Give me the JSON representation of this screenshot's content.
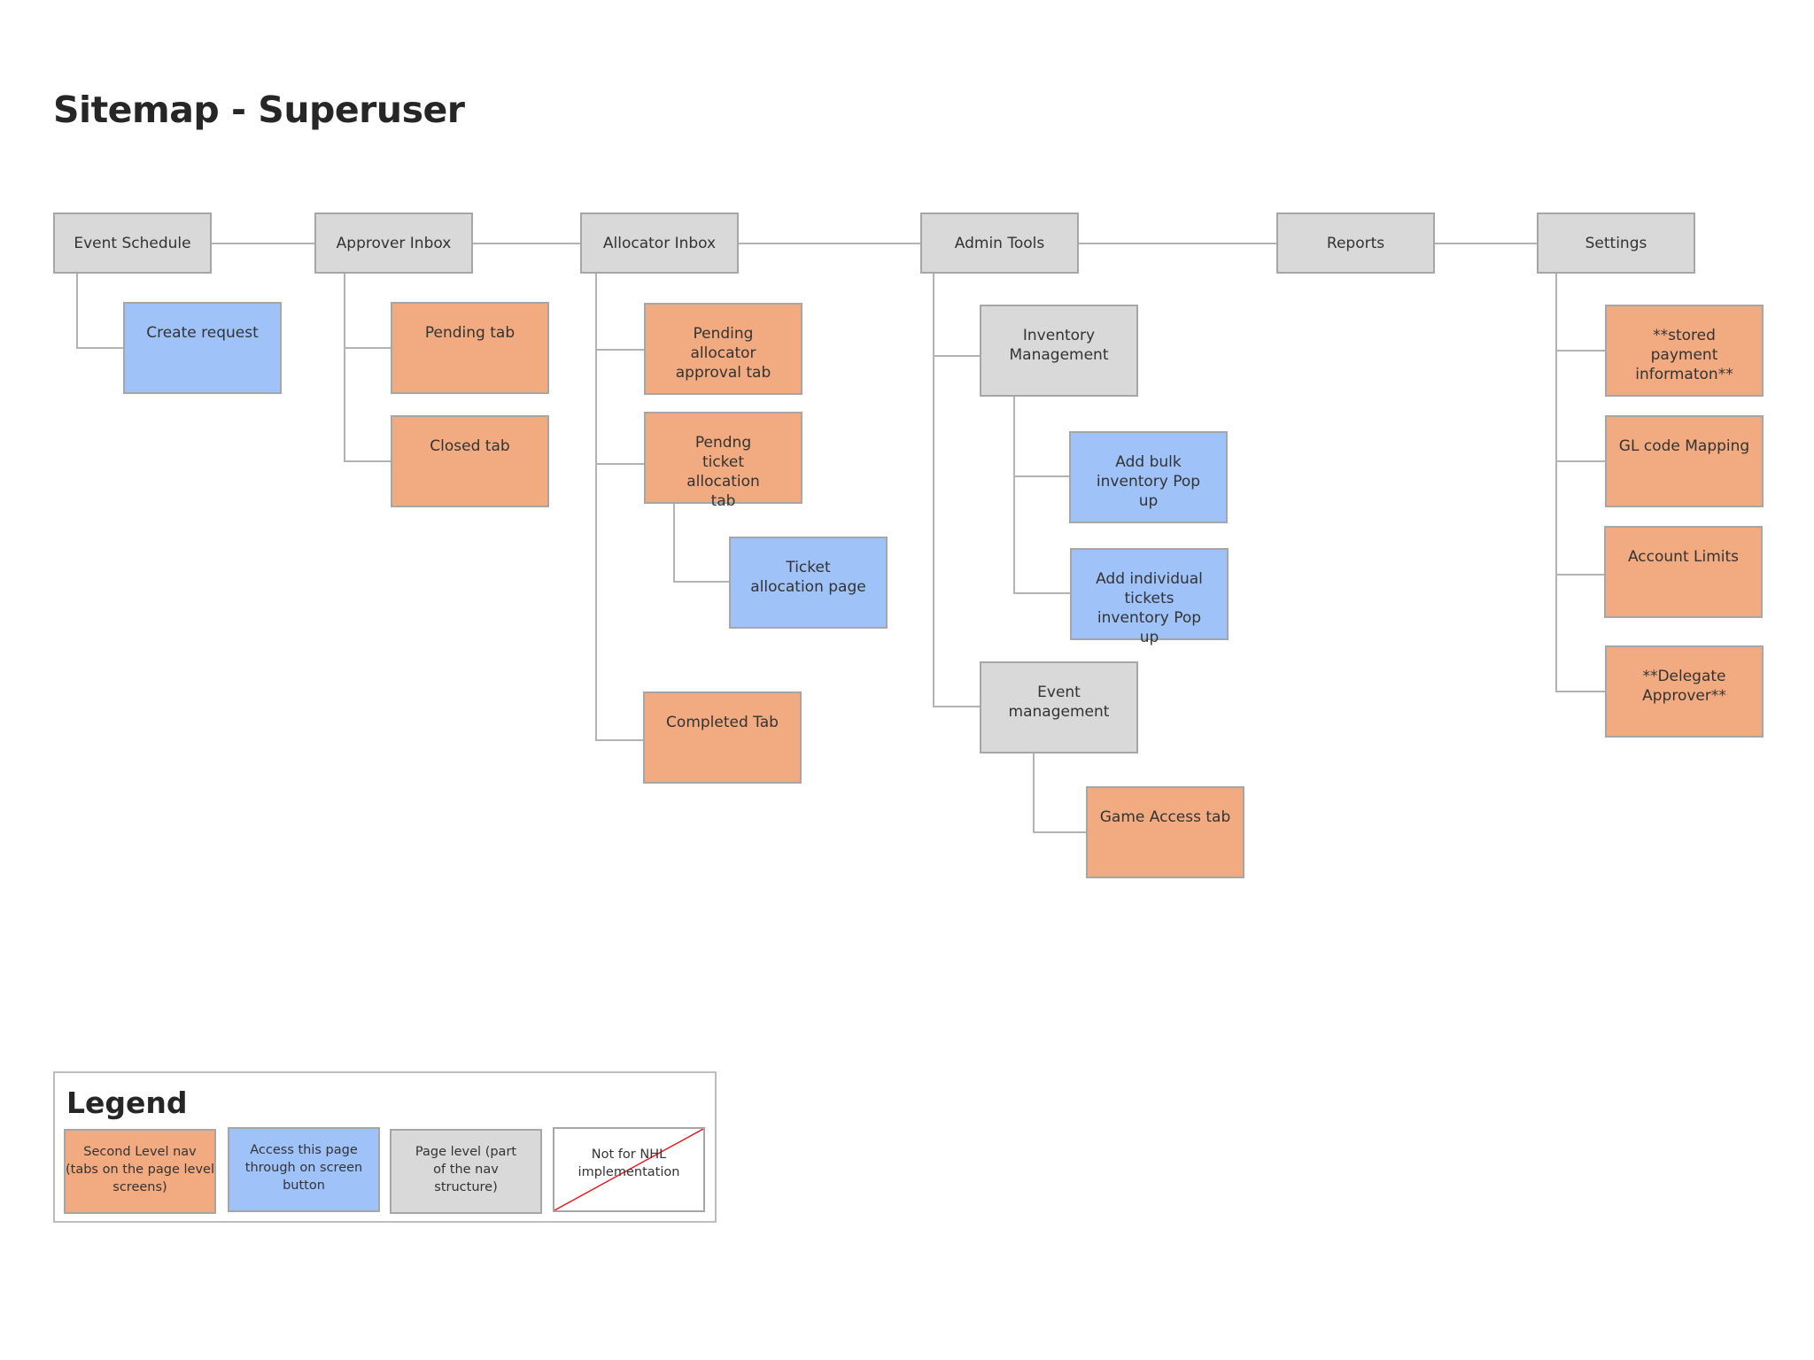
{
  "title": "Sitemap - Superuser",
  "colors": {
    "page_level": "#d9d9d9",
    "second_level_nav": "#f2ab80",
    "on_screen_button": "#9fc2f9",
    "border": "#a6a6a6",
    "connector": "#b3b3b3",
    "strike": "#e8141c"
  },
  "nav": {
    "event_schedule": {
      "label": "Event Schedule",
      "children": {
        "create_request": "Create request"
      }
    },
    "approver_inbox": {
      "label": "Approver Inbox",
      "children": {
        "pending_tab": "Pending tab",
        "closed_tab": "Closed tab"
      }
    },
    "allocator_inbox": {
      "label": "Allocator Inbox",
      "children": {
        "pending_allocator_approval_tab": "Pending allocator approval tab",
        "pending_ticket_allocation_tab": "Pendng ticket allocation tab",
        "ticket_allocation_page": "Ticket allocation page",
        "completed_tab": "Completed Tab"
      }
    },
    "admin_tools": {
      "label": "Admin Tools",
      "children": {
        "inventory_management": "Inventory Management",
        "add_bulk_inventory_popup": "Add bulk inventory Pop up",
        "add_individual_tickets_inventory_popup": "Add individual tickets inventory Pop up",
        "event_management": "Event management",
        "game_access_tab": "Game Access tab"
      }
    },
    "reports": {
      "label": "Reports"
    },
    "settings": {
      "label": "Settings",
      "children": {
        "stored_payment_information": "**stored payment informaton**",
        "gl_code_mapping": "GL code Mapping",
        "account_limits": "Account Limits",
        "delegate_approver": "**Delegate Approver**"
      }
    }
  },
  "legend": {
    "title": "Legend",
    "items": [
      {
        "label": "Second Level nav (tabs on the page level screens)",
        "type": "orange"
      },
      {
        "label": "Access this page through on screen button",
        "type": "blue"
      },
      {
        "label": "Page level (part of the nav structure)",
        "type": "gray"
      },
      {
        "label": "Not for NHL implementation",
        "type": "struck-white"
      }
    ]
  }
}
